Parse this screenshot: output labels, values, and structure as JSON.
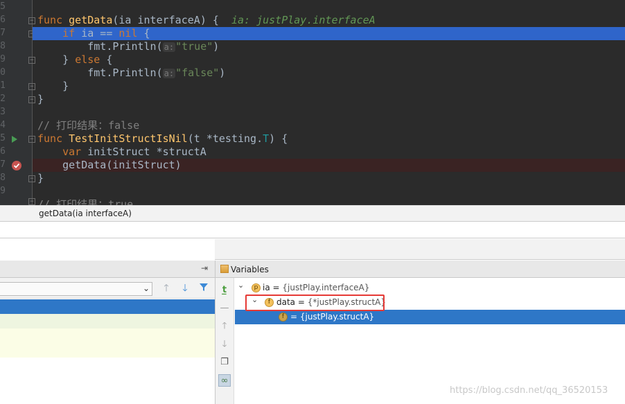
{
  "gutter": {
    "line_numbers": [
      "5",
      "6",
      "7",
      "8",
      "9",
      "0",
      "1",
      "2",
      "3",
      "4",
      "5",
      "6",
      "7",
      "8",
      "9"
    ]
  },
  "code": {
    "line1": {
      "kw": "func",
      "fn": "getData",
      "open": "(",
      "param": "ia",
      "sp": " ",
      "type": "interfaceA",
      "close": ") {",
      "hint": "ia: justPlay.interfaceA"
    },
    "line2": {
      "kw": "if",
      "rest": " ia == ",
      "nil": "nil",
      "tail": " {"
    },
    "line3": {
      "pre": "fmt.Println(",
      "hint": "a:",
      "str": "\"true\"",
      "post": ")"
    },
    "line4": {
      "pre": "} ",
      "kw": "else",
      "post": " {"
    },
    "line5": {
      "pre": "fmt.Println(",
      "hint": "a:",
      "str": "\"false\"",
      "post": ")"
    },
    "line6": "}",
    "line7": "}",
    "line9": "// 打印结果：false",
    "line10": {
      "kw": "func",
      "fn": "TestInitStructIsNil",
      "args": "(t *testing.",
      "T": "T",
      ") ": ") {"
    },
    "line11": {
      "kw": "var",
      "name": " initStruct",
      "type": " *structA"
    },
    "line12": "getData(initStruct)",
    "line13": "}",
    "line15": "// 打印结果：true"
  },
  "breadcrumb": "getData(ia interfaceA)",
  "frames_header": {
    "pin": "⇥"
  },
  "variables": {
    "title": "Variables",
    "rows": [
      {
        "badge": "p",
        "name": "ia",
        "eq": " = ",
        "value": "{justPlay.interfaceA}"
      },
      {
        "badge": "f",
        "name": "data",
        "eq": " = ",
        "value": "{*justPlay.structA}"
      },
      {
        "badge": "f",
        "name": "",
        "eq": " = ",
        "value": "{justPlay.structA}"
      }
    ]
  },
  "watermark": "https://blog.csdn.net/qq_36520153",
  "colors": {
    "selection": "#2f65ca",
    "frame_sel": "#2e77c7",
    "breakpoint_line": "#3a2323",
    "highlight_box": "#e53935"
  }
}
